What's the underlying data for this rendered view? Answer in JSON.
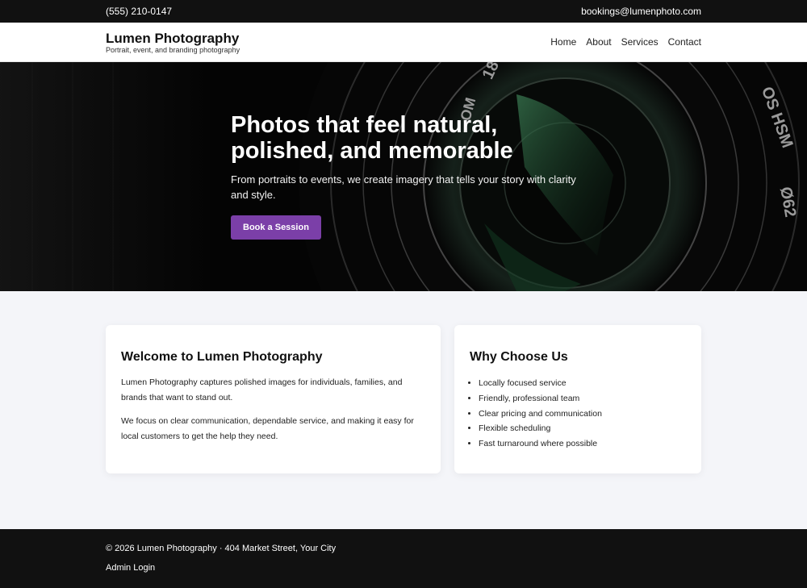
{
  "topbar": {
    "phone": "(555) 210-0147",
    "email": "bookings@lumenphoto.com"
  },
  "header": {
    "brand_name": "Lumen Photography",
    "tagline": "Portrait, event, and branding photography",
    "nav": [
      "Home",
      "About",
      "Services",
      "Contact"
    ]
  },
  "hero": {
    "title_line1": "Photos that feel natural,",
    "title_line2": "polished, and memorable",
    "subtitle": "From portraits to events, we create imagery that tells your story with clarity and style.",
    "cta_label": "Book a Session",
    "lens_markings": [
      "18",
      "OS HSM",
      "Ø62",
      "OM"
    ]
  },
  "welcome_card": {
    "heading": "Welcome to Lumen Photography",
    "para1": "Lumen Photography captures polished images for individuals, families, and brands that want to stand out.",
    "para2": "We focus on clear communication, dependable service, and making it easy for local customers to get the help they need."
  },
  "why_card": {
    "heading": "Why Choose Us",
    "items": [
      "Locally focused service",
      "Friendly, professional team",
      "Clear pricing and communication",
      "Flexible scheduling",
      "Fast turnaround where possible"
    ]
  },
  "footer": {
    "copyright": "© 2026 Lumen Photography · 404 Market Street, Your City",
    "admin_link": "Admin Login"
  },
  "colors": {
    "accent": "#7b3fa8",
    "dark": "#111111",
    "page_bg": "#f4f5f9"
  }
}
